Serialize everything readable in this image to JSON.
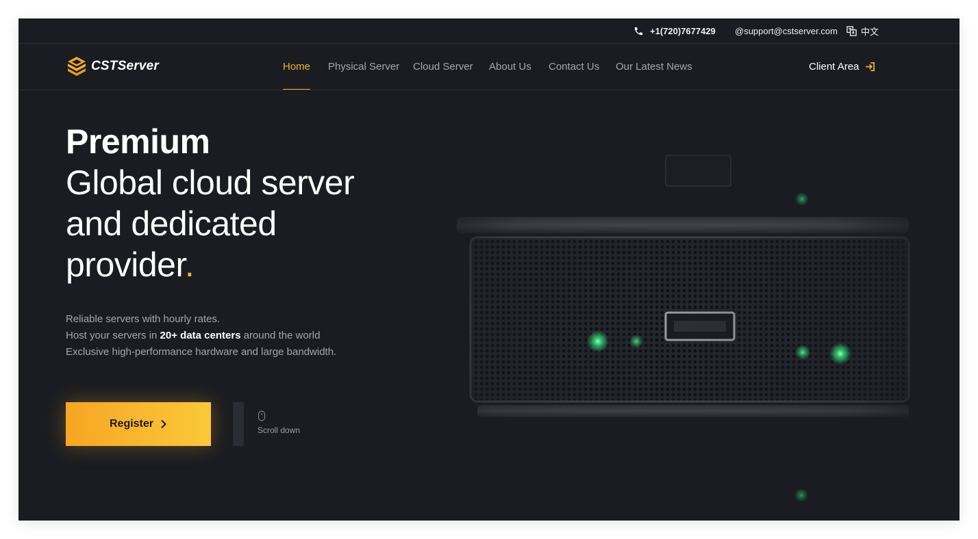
{
  "topbar": {
    "phone": "+1(720)7677429",
    "email": "@support@cstserver.com",
    "language": "中文"
  },
  "brand": {
    "name": "CSTServer",
    "accent_color": "#f0b429"
  },
  "nav": {
    "items": [
      {
        "label": "Home",
        "active": true
      },
      {
        "label": "Physical Server",
        "active": false
      },
      {
        "label": "Cloud Server",
        "active": false
      },
      {
        "label": "About Us",
        "active": false
      },
      {
        "label": "Contact Us",
        "active": false
      },
      {
        "label": "Our Latest News",
        "active": false
      }
    ],
    "client_area": "Client Area"
  },
  "hero": {
    "headline_strong": "Premium",
    "headline_lines": [
      "Global cloud server",
      "and dedicated",
      "provider"
    ],
    "headline_dot": ".",
    "desc_line1": "Reliable servers with hourly rates.",
    "desc_line2_pre": "Host your servers in ",
    "desc_line2_bold": "20+ data centers",
    "desc_line2_post": " around the world",
    "desc_line3": "Exclusive high-performance hardware and large bandwidth.",
    "register_label": "Register",
    "scroll_label": "Scroll down"
  },
  "icons": {
    "phone": "phone-icon",
    "language": "translate-icon",
    "client_area": "login-arrow-icon",
    "register": "chevron-right-icon",
    "scroll": "mouse-icon",
    "logo": "stacked-s-logo-icon"
  }
}
